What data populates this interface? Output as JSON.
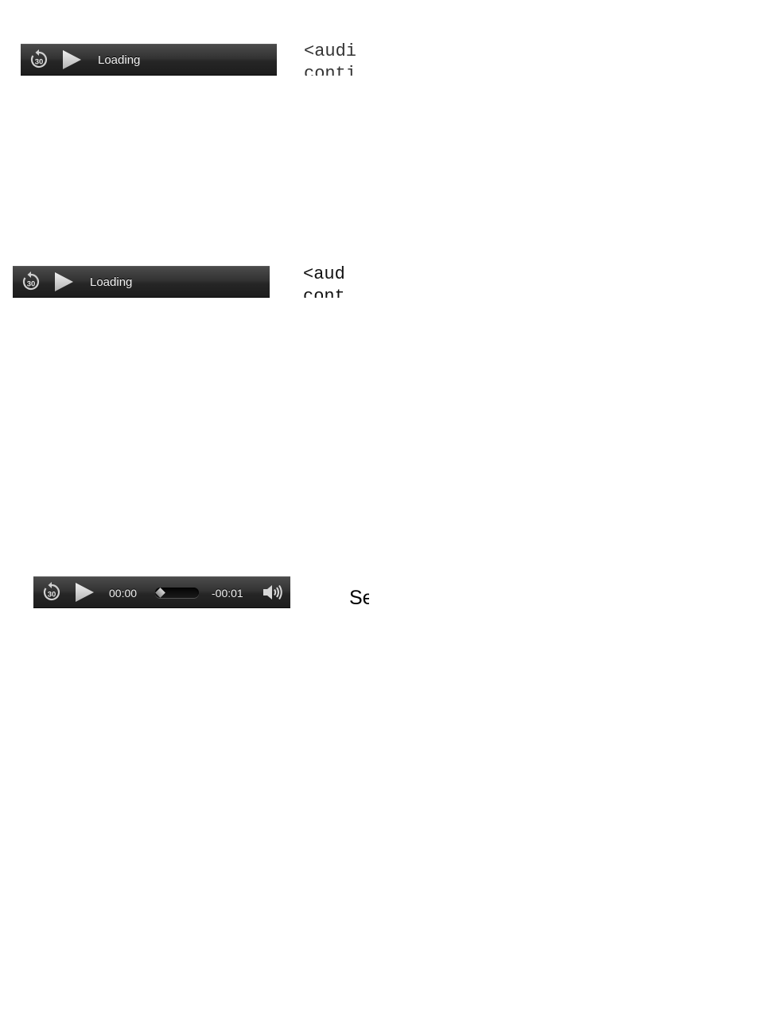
{
  "players": [
    {
      "status_label": "Loading",
      "rewind_seconds": "30"
    },
    {
      "status_label": "Loading",
      "rewind_seconds": "30"
    },
    {
      "rewind_seconds": "30",
      "elapsed_time": "00:00",
      "remaining_time": "-00:01",
      "progress_fraction": 0
    }
  ],
  "code_fragments": [
    {
      "line1": "<audi",
      "line2": "conti"
    },
    {
      "line1": "<aud",
      "line2": "cont"
    }
  ],
  "side_text": "Se",
  "colors": {
    "player_bar": "#2b2b2b",
    "player_text": "#f2f2f2",
    "icon_fill": "#d0d0d0"
  },
  "icons": {
    "rewind": "rewind-30-icon",
    "play": "play-icon",
    "volume": "volume-icon"
  }
}
